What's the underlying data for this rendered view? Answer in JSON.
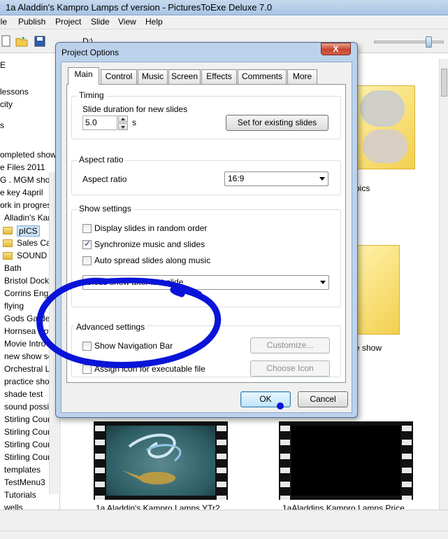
{
  "window": {
    "title": "1a Aladdin's Kampro Lamps cf version - PicturesToExe Deluxe 7.0",
    "menu": [
      "ile",
      "Publish",
      "Project",
      "Slide",
      "View",
      "Help"
    ],
    "path": "D:\\"
  },
  "tree": {
    "items": [
      "E",
      "lessons",
      "city",
      "s",
      "ompleted show",
      "e Files 2011",
      "G . MGM sho",
      "e key 4april",
      "ork in progres",
      "Alladin's Kar",
      "pICS",
      "Sales Cat",
      "SOUND",
      "Bath",
      "Bristol Dock",
      "Corrins Eng",
      "flying",
      "Gods Garder",
      "Hornsea Pott",
      "Movie Intro",
      "new show se",
      "Orchestral L",
      "practice sho",
      "shade test",
      "sound possi",
      "Stirling Cour",
      "Stirling Cour",
      "Stirling Cour",
      "Stirling Cour",
      "templates",
      "TestMenu3",
      "Tutorials",
      "wells"
    ]
  },
  "pane": {
    "folder1_label": "pics",
    "folder2_label": "e show",
    "thumb1_label": "1a Aladdin's Kampro Lamps YTr2...",
    "thumb2_label": "1aAladdins Kampro Lamps Price..."
  },
  "dialog": {
    "title": "Project Options",
    "close": "X",
    "tabs": [
      "Main",
      "Control",
      "Music",
      "Screen",
      "Effects",
      "Comments",
      "More"
    ],
    "timing": {
      "title": "Timing",
      "duration_label": "Slide duration for new slides",
      "duration_value": "5.0",
      "unit": "s",
      "set_existing": "Set for existing slides"
    },
    "aspect": {
      "title": "Aspect ratio",
      "label": "Aspect ratio",
      "value": "16:9"
    },
    "show": {
      "title": "Show settings",
      "random": "Display slides in random order",
      "random_checked": false,
      "sync": "Synchronize music and slides",
      "sync_checked": true,
      "spread": "Auto spread slides along music",
      "spread_checked": false,
      "after_show": "Close show after last slide"
    },
    "advanced": {
      "title": "Advanced settings",
      "navbar": "Show Navigation Bar",
      "navbar_checked": false,
      "customize": "Customize...",
      "assign_icon": "Assign icon for executable file",
      "assign_icon_checked": false,
      "choose_icon": "Choose Icon"
    },
    "ok": "OK",
    "cancel": "Cancel"
  },
  "colors": {
    "annotation": "#0a14d8",
    "dialog_frame": "#bcd2ec"
  }
}
